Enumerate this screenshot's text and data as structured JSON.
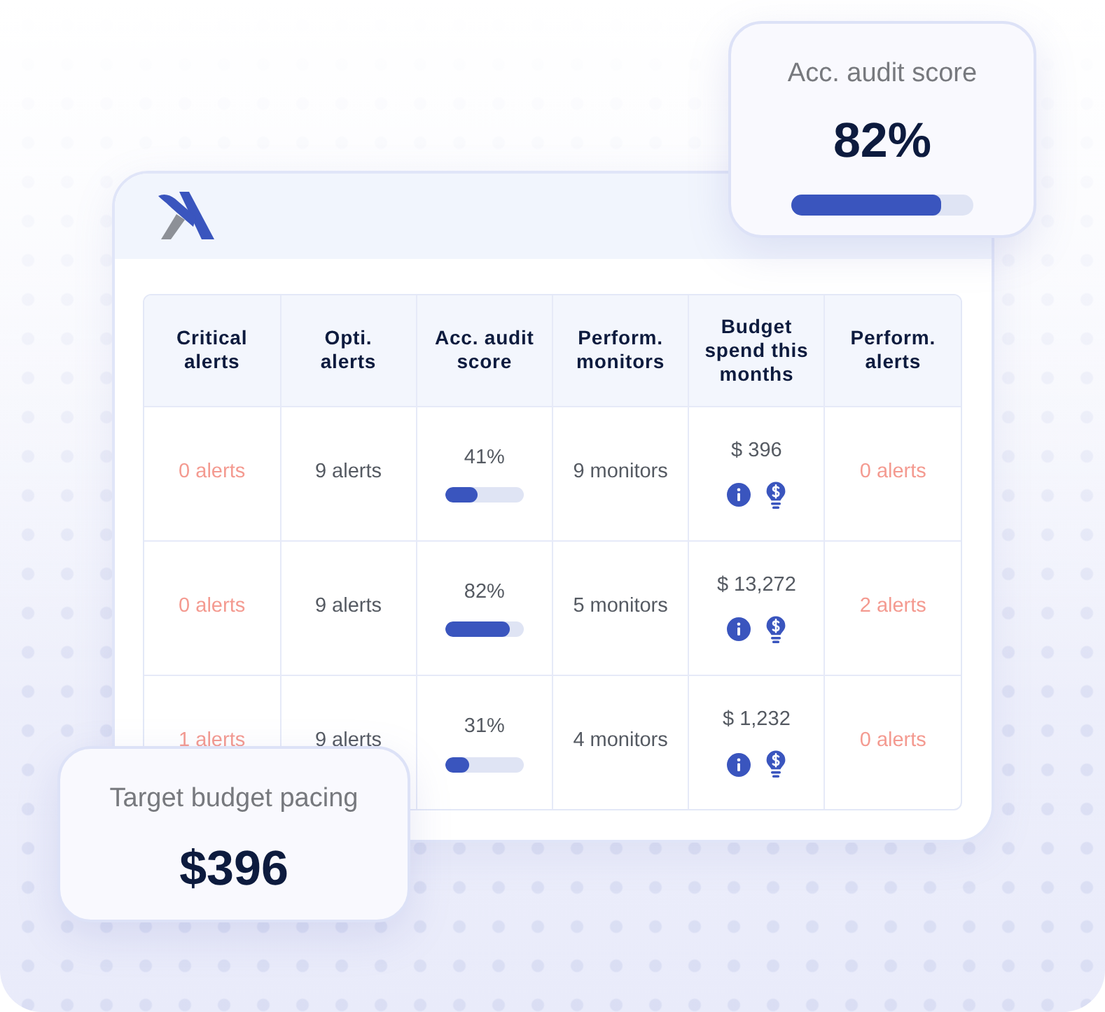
{
  "audit_card": {
    "title": "Acc. audit score",
    "value": "82%",
    "level": 0.82
  },
  "table": {
    "columns": [
      {
        "label": "Critical alerts",
        "kind": "alert"
      },
      {
        "label": "Opti. alerts",
        "kind": "count"
      },
      {
        "label": "Acc. audit score",
        "kind": "score"
      },
      {
        "label": "Perform. monitors",
        "kind": "count"
      },
      {
        "label": "Budget spend this months",
        "kind": "budget"
      },
      {
        "label": "Perform. alerts",
        "kind": "alert"
      }
    ],
    "rows": [
      {
        "cells": [
          "0 alerts",
          "9 alerts",
          {
            "reading": "41%",
            "level": 0.41
          },
          "9 monitors",
          "$ 396",
          "0 alerts"
        ]
      },
      {
        "cells": [
          "0 alerts",
          "9 alerts",
          {
            "reading": "82%",
            "level": 0.82
          },
          "5 monitors",
          "$ 13,272",
          "2 alerts"
        ]
      },
      {
        "cells": [
          "1 alerts",
          "9 alerts",
          {
            "reading": "31%",
            "level": 0.31
          },
          "4 monitors",
          "$ 1,232",
          "0 alerts"
        ]
      }
    ]
  },
  "pacing_card": {
    "title": "Target budget pacing",
    "value": "$396"
  }
}
